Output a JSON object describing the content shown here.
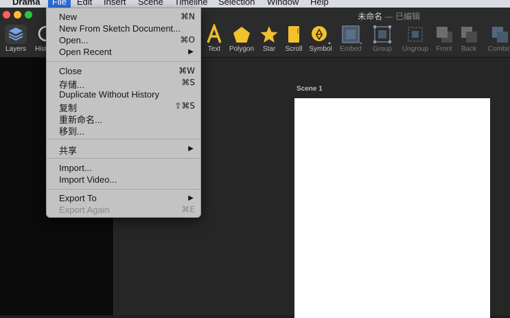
{
  "menubar": {
    "app": "Drama",
    "items": [
      "File",
      "Edit",
      "Insert",
      "Scene",
      "Timeline",
      "Selection",
      "Window",
      "Help"
    ]
  },
  "window": {
    "title": "未命名",
    "title_status": "— 已编辑"
  },
  "toolbar": {
    "left": [
      {
        "label": "Layers",
        "icon": "layers-icon"
      },
      {
        "label": "Hist",
        "icon": "history-icon"
      }
    ],
    "tools": [
      {
        "label": "Text",
        "icon": "text-icon"
      },
      {
        "label": "Polygon",
        "icon": "polygon-icon"
      },
      {
        "label": "Star",
        "icon": "star-icon"
      },
      {
        "label": "Scroll",
        "icon": "scroll-icon"
      },
      {
        "label": "Symbol",
        "icon": "symbol-icon"
      },
      {
        "label": "Embed",
        "icon": "embed-icon"
      },
      {
        "label": "Group",
        "icon": "group-icon"
      },
      {
        "label": "Ungroup",
        "icon": "ungroup-icon"
      },
      {
        "label": "Front",
        "icon": "front-icon"
      },
      {
        "label": "Back",
        "icon": "back-icon"
      },
      {
        "label": "Combin",
        "icon": "combine-icon"
      }
    ]
  },
  "canvas": {
    "scene_label": "Scene 1"
  },
  "file_menu": {
    "items": [
      {
        "label": "New",
        "shortcut": "⌘N"
      },
      {
        "label": "New From Sketch Document...",
        "shortcut": ""
      },
      {
        "label": "Open...",
        "shortcut": "⌘O"
      },
      {
        "label": "Open Recent",
        "shortcut": "▶"
      },
      {
        "label": "Close",
        "shortcut": "⌘W"
      },
      {
        "label": "存储...",
        "shortcut": "⌘S"
      },
      {
        "label": "Duplicate Without History",
        "shortcut": ""
      },
      {
        "label": "复制",
        "shortcut": "⇧⌘S"
      },
      {
        "label": "重新命名...",
        "shortcut": ""
      },
      {
        "label": "移到...",
        "shortcut": ""
      },
      {
        "label": "共享",
        "shortcut": "▶"
      },
      {
        "label": "Import...",
        "shortcut": ""
      },
      {
        "label": "Import Video...",
        "shortcut": ""
      },
      {
        "label": "Export To",
        "shortcut": "▶"
      },
      {
        "label": "Export Again",
        "shortcut": "⌘E"
      }
    ]
  },
  "colors": {
    "accent": "#2f6ddb",
    "tool_icon": "#f2c12e",
    "artboard": "#ffffff"
  }
}
